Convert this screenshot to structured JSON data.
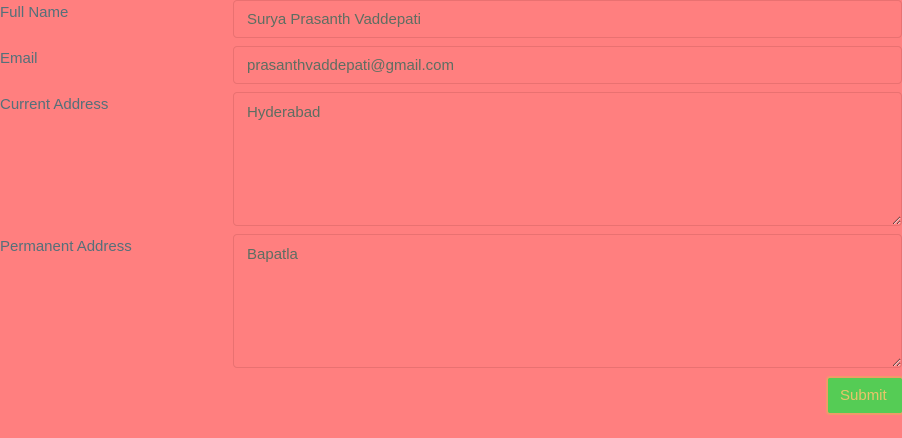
{
  "form": {
    "full_name": {
      "label": "Full Name",
      "value": "Surya Prasanth Vaddepati"
    },
    "email": {
      "label": "Email",
      "value": "prasanthvaddepati@gmail.com"
    },
    "current_address": {
      "label": "Current Address",
      "value": "Hyderabad"
    },
    "permanent_address": {
      "label": "Permanent Address",
      "value": "Bapatla"
    },
    "submit_label": "Submit"
  },
  "colors": {
    "background": "#ff7f7f",
    "submit_button": "#55cc55"
  }
}
